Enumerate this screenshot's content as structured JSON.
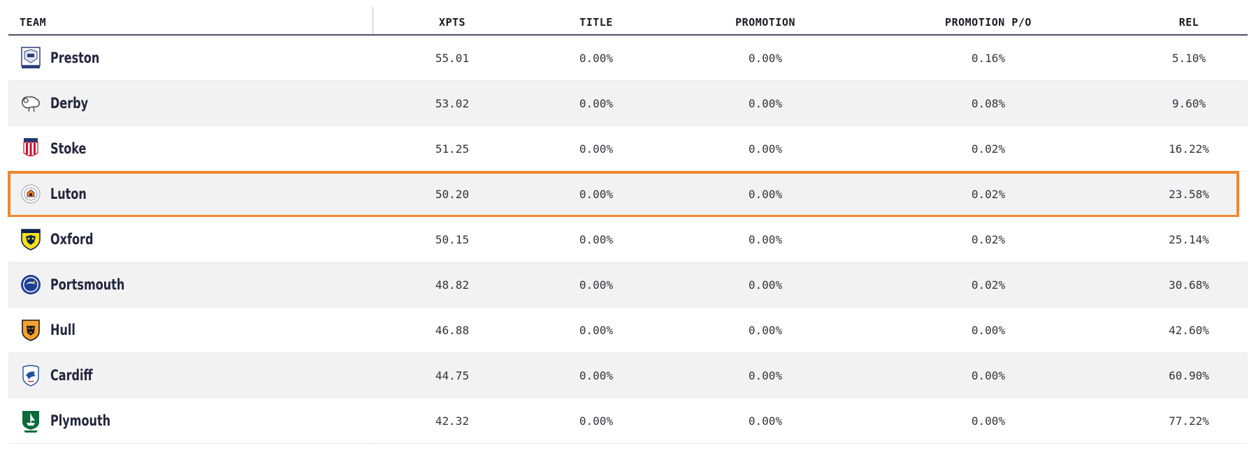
{
  "columns": {
    "team": "TEAM",
    "xpts": "XPTS",
    "title": "TITLE",
    "promotion": "PROMOTION",
    "promotion_po": "PROMOTION P/O",
    "rel": "REL"
  },
  "highlight_color": "#f08732",
  "rows": [
    {
      "team": "Preston",
      "crest": "preston-crest-icon",
      "xpts": "55.01",
      "title": "0.00%",
      "promotion": "0.00%",
      "promotion_po": "0.16%",
      "rel": "5.10%"
    },
    {
      "team": "Derby",
      "crest": "derby-ram-crest-icon",
      "xpts": "53.02",
      "title": "0.00%",
      "promotion": "0.00%",
      "promotion_po": "0.08%",
      "rel": "9.60%"
    },
    {
      "team": "Stoke",
      "crest": "stoke-crest-icon",
      "xpts": "51.25",
      "title": "0.00%",
      "promotion": "0.00%",
      "promotion_po": "0.02%",
      "rel": "16.22%"
    },
    {
      "team": "Luton",
      "crest": "luton-crest-icon",
      "xpts": "50.20",
      "title": "0.00%",
      "promotion": "0.00%",
      "promotion_po": "0.02%",
      "rel": "23.58%",
      "highlighted": true
    },
    {
      "team": "Oxford",
      "crest": "oxford-crest-icon",
      "xpts": "50.15",
      "title": "0.00%",
      "promotion": "0.00%",
      "promotion_po": "0.02%",
      "rel": "25.14%"
    },
    {
      "team": "Portsmouth",
      "crest": "portsmouth-crest-icon",
      "xpts": "48.82",
      "title": "0.00%",
      "promotion": "0.00%",
      "promotion_po": "0.02%",
      "rel": "30.68%"
    },
    {
      "team": "Hull",
      "crest": "hull-tiger-crest-icon",
      "xpts": "46.88",
      "title": "0.00%",
      "promotion": "0.00%",
      "promotion_po": "0.00%",
      "rel": "42.60%"
    },
    {
      "team": "Cardiff",
      "crest": "cardiff-bluebird-crest-icon",
      "xpts": "44.75",
      "title": "0.00%",
      "promotion": "0.00%",
      "promotion_po": "0.00%",
      "rel": "60.90%"
    },
    {
      "team": "Plymouth",
      "crest": "plymouth-ship-crest-icon",
      "xpts": "42.32",
      "title": "0.00%",
      "promotion": "0.00%",
      "promotion_po": "0.00%",
      "rel": "77.22%"
    }
  ]
}
